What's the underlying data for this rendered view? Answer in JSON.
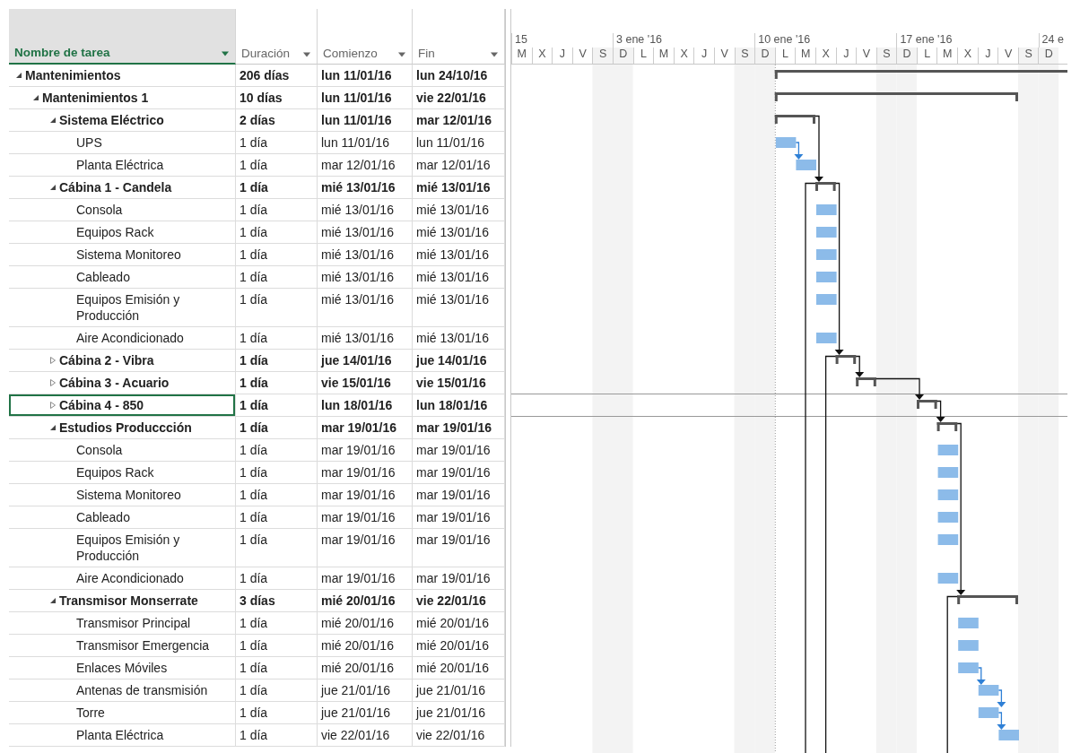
{
  "columns": [
    {
      "label": "Nombre de tarea",
      "selected": true
    },
    {
      "label": "Duración",
      "selected": false
    },
    {
      "label": "Comienzo",
      "selected": false
    },
    {
      "label": "Fin",
      "selected": false
    }
  ],
  "timeline": {
    "weeks": [
      "15",
      "3 ene '16",
      "10 ene '16",
      "17 ene '16",
      "24 e"
    ],
    "days": [
      {
        "letter": "M",
        "weekend": false
      },
      {
        "letter": "X",
        "weekend": false
      },
      {
        "letter": "J",
        "weekend": false
      },
      {
        "letter": "V",
        "weekend": false
      },
      {
        "letter": "S",
        "weekend": true
      },
      {
        "letter": "D",
        "weekend": true
      },
      {
        "letter": "L",
        "weekend": false
      },
      {
        "letter": "M",
        "weekend": false
      },
      {
        "letter": "X",
        "weekend": false
      },
      {
        "letter": "J",
        "weekend": false
      },
      {
        "letter": "V",
        "weekend": false
      },
      {
        "letter": "S",
        "weekend": true
      },
      {
        "letter": "D",
        "weekend": true
      },
      {
        "letter": "L",
        "weekend": false
      },
      {
        "letter": "M",
        "weekend": false
      },
      {
        "letter": "X",
        "weekend": false
      },
      {
        "letter": "J",
        "weekend": false
      },
      {
        "letter": "V",
        "weekend": false
      },
      {
        "letter": "S",
        "weekend": true
      },
      {
        "letter": "D",
        "weekend": true
      },
      {
        "letter": "L",
        "weekend": false
      },
      {
        "letter": "M",
        "weekend": false
      },
      {
        "letter": "X",
        "weekend": false
      },
      {
        "letter": "J",
        "weekend": false
      },
      {
        "letter": "V",
        "weekend": false
      },
      {
        "letter": "S",
        "weekend": true
      },
      {
        "letter": "D",
        "weekend": true
      }
    ]
  },
  "tasks": [
    {
      "name": "Mantenimientos",
      "kind": "summary",
      "expanded": true,
      "selected": false,
      "duration": "206 días",
      "start": "lun 11/01/16",
      "finish": "lun 24/10/16",
      "children": [
        {
          "name": "Mantenimientos 1",
          "kind": "summary",
          "expanded": true,
          "selected": false,
          "duration": "10 días",
          "start": "lun 11/01/16",
          "finish": "vie 22/01/16",
          "children": [
            {
              "name": "Sistema Eléctrico",
              "kind": "summary",
              "expanded": true,
              "selected": false,
              "duration": "2 días",
              "start": "lun 11/01/16",
              "finish": "mar 12/01/16",
              "link_next": true,
              "children": [
                {
                  "name": "UPS",
                  "kind": "task",
                  "selected": false,
                  "duration": "1 día",
                  "start": "lun 11/01/16",
                  "finish": "lun 11/01/16",
                  "link_next": true
                },
                {
                  "name": "Planta Eléctrica",
                  "kind": "task",
                  "selected": false,
                  "duration": "1 día",
                  "start": "mar 12/01/16",
                  "finish": "mar 12/01/16"
                }
              ]
            },
            {
              "name": "Cábina 1 - Candela",
              "kind": "summary",
              "expanded": true,
              "selected": false,
              "duration": "1 día",
              "start": "mié 13/01/16",
              "finish": "mié 13/01/16",
              "link_next": true,
              "link_down": true,
              "children": [
                {
                  "name": "Consola",
                  "kind": "task",
                  "selected": false,
                  "duration": "1 día",
                  "start": "mié 13/01/16",
                  "finish": "mié 13/01/16"
                },
                {
                  "name": "Equipos Rack",
                  "kind": "task",
                  "selected": false,
                  "duration": "1 día",
                  "start": "mié 13/01/16",
                  "finish": "mié 13/01/16"
                },
                {
                  "name": "Sistema Monitoreo",
                  "kind": "task",
                  "selected": false,
                  "duration": "1 día",
                  "start": "mié 13/01/16",
                  "finish": "mié 13/01/16"
                },
                {
                  "name": "Cableado",
                  "kind": "task",
                  "selected": false,
                  "duration": "1 día",
                  "start": "mié 13/01/16",
                  "finish": "mié 13/01/16"
                },
                {
                  "name": "Equipos Emisión y Producción",
                  "kind": "task",
                  "selected": false,
                  "duration": "1 día",
                  "start": "mié 13/01/16",
                  "finish": "mié 13/01/16"
                },
                {
                  "name": "Aire Acondicionado",
                  "kind": "task",
                  "selected": false,
                  "duration": "1 día",
                  "start": "mié 13/01/16",
                  "finish": "mié 13/01/16"
                }
              ]
            },
            {
              "name": "Cábina 2 - Vibra",
              "kind": "summary",
              "expanded": false,
              "selected": false,
              "duration": "1 día",
              "start": "jue 14/01/16",
              "finish": "jue 14/01/16",
              "link_next": true,
              "link_down": true
            },
            {
              "name": "Cábina 3 - Acuario",
              "kind": "summary",
              "expanded": false,
              "selected": false,
              "duration": "1 día",
              "start": "vie 15/01/16",
              "finish": "vie 15/01/16",
              "link_next": true
            },
            {
              "name": "Cábina 4 - 850",
              "kind": "summary",
              "expanded": false,
              "selected": true,
              "duration": "1 día",
              "start": "lun 18/01/16",
              "finish": "lun 18/01/16",
              "link_next": true
            },
            {
              "name": "Estudios Produccción",
              "kind": "summary",
              "expanded": true,
              "selected": false,
              "duration": "1 día",
              "start": "mar 19/01/16",
              "finish": "mar 19/01/16",
              "link_next": true,
              "children": [
                {
                  "name": "Consola",
                  "kind": "task",
                  "selected": false,
                  "duration": "1 día",
                  "start": "mar 19/01/16",
                  "finish": "mar 19/01/16"
                },
                {
                  "name": "Equipos Rack",
                  "kind": "task",
                  "selected": false,
                  "duration": "1 día",
                  "start": "mar 19/01/16",
                  "finish": "mar 19/01/16"
                },
                {
                  "name": "Sistema Monitoreo",
                  "kind": "task",
                  "selected": false,
                  "duration": "1 día",
                  "start": "mar 19/01/16",
                  "finish": "mar 19/01/16"
                },
                {
                  "name": "Cableado",
                  "kind": "task",
                  "selected": false,
                  "duration": "1 día",
                  "start": "mar 19/01/16",
                  "finish": "mar 19/01/16"
                },
                {
                  "name": "Equipos Emisión y Producción",
                  "kind": "task",
                  "selected": false,
                  "duration": "1 día",
                  "start": "mar 19/01/16",
                  "finish": "mar 19/01/16"
                },
                {
                  "name": "Aire Acondicionado",
                  "kind": "task",
                  "selected": false,
                  "duration": "1 día",
                  "start": "mar 19/01/16",
                  "finish": "mar 19/01/16"
                }
              ]
            },
            {
              "name": "Transmisor Monserrate",
              "kind": "summary",
              "expanded": true,
              "selected": false,
              "duration": "3 días",
              "start": "mié 20/01/16",
              "finish": "vie 22/01/16",
              "link_down": true,
              "children": [
                {
                  "name": "Transmisor Principal",
                  "kind": "task",
                  "selected": false,
                  "duration": "1 día",
                  "start": "mié 20/01/16",
                  "finish": "mié 20/01/16"
                },
                {
                  "name": "Transmisor Emergencia",
                  "kind": "task",
                  "selected": false,
                  "duration": "1 día",
                  "start": "mié 20/01/16",
                  "finish": "mié 20/01/16"
                },
                {
                  "name": "Enlaces Móviles",
                  "kind": "task",
                  "selected": false,
                  "duration": "1 día",
                  "start": "mié 20/01/16",
                  "finish": "mié 20/01/16",
                  "link_next": true
                },
                {
                  "name": "Antenas de transmisión",
                  "kind": "task",
                  "selected": false,
                  "duration": "1 día",
                  "start": "jue 21/01/16",
                  "finish": "jue 21/01/16",
                  "link_next": true
                },
                {
                  "name": "Torre",
                  "kind": "task",
                  "selected": false,
                  "duration": "1 día",
                  "start": "jue 21/01/16",
                  "finish": "jue 21/01/16",
                  "link_next": true
                },
                {
                  "name": "Planta Eléctrica",
                  "kind": "task",
                  "selected": false,
                  "duration": "1 día",
                  "start": "vie 22/01/16",
                  "finish": "vie 22/01/16"
                }
              ]
            }
          ]
        }
      ]
    }
  ]
}
